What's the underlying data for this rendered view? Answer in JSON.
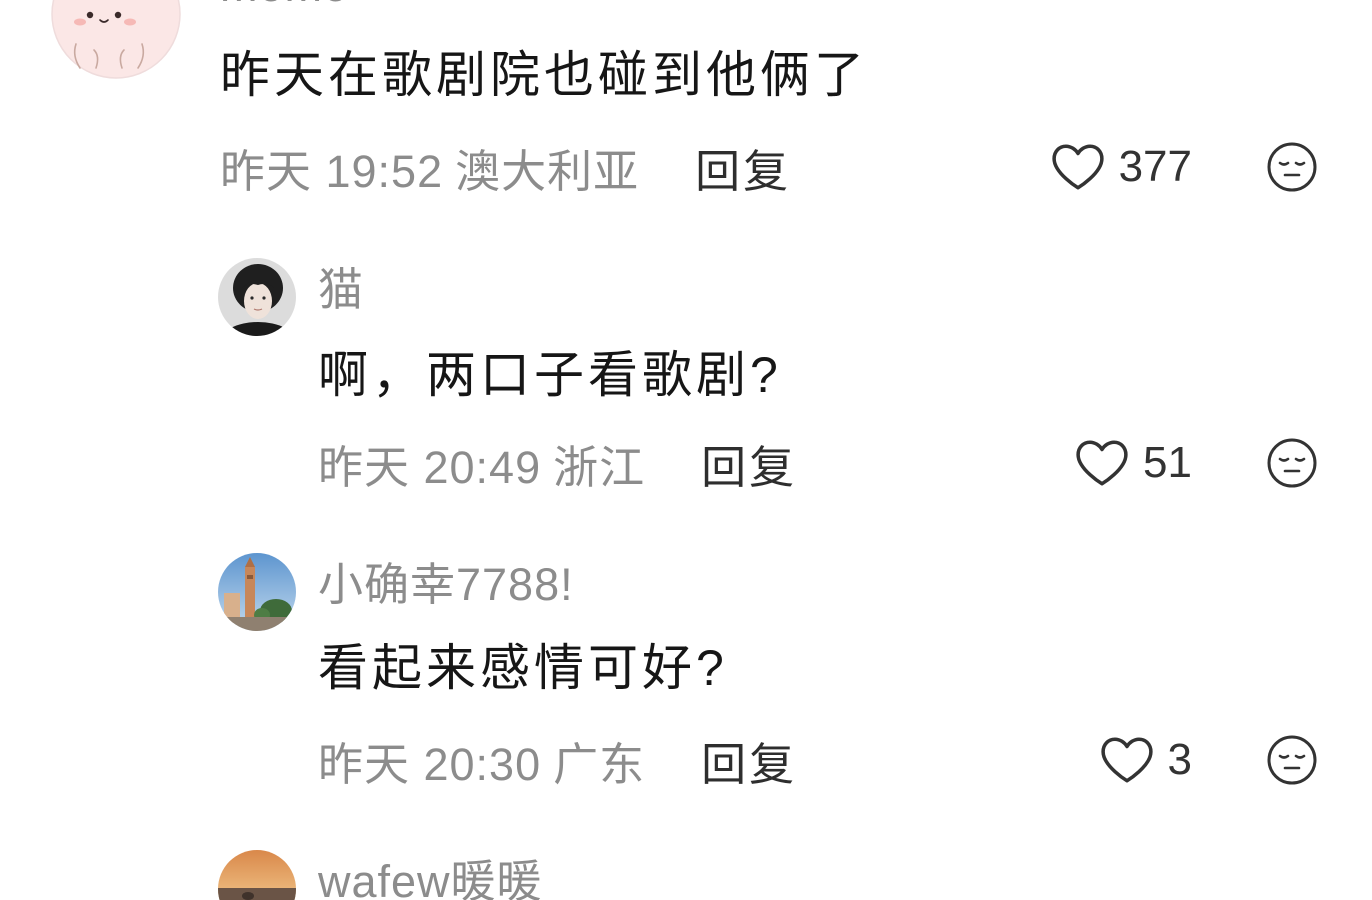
{
  "colors": {
    "background": "#ffffff",
    "text": "#161616",
    "meta": "#8c8c8c",
    "action": "#2e2e2e"
  },
  "icons": {
    "like": "heart-icon",
    "dislike": "meh-face-icon"
  },
  "comment": {
    "username": "momo",
    "text": "昨天在歌剧院也碰到他俩了",
    "time": "昨天 19:52",
    "location": "澳大利亚",
    "reply_label": "回复",
    "likes": "377"
  },
  "replies": [
    {
      "username": "猫",
      "text": "啊，两口子看歌剧?",
      "time": "昨天 20:49",
      "location": "浙江",
      "reply_label": "回复",
      "likes": "51"
    },
    {
      "username": "小确幸7788!",
      "text": "看起来感情可好?",
      "time": "昨天 20:30",
      "location": "广东",
      "reply_label": "回复",
      "likes": "3"
    },
    {
      "username": "wafew暖暖"
    }
  ]
}
